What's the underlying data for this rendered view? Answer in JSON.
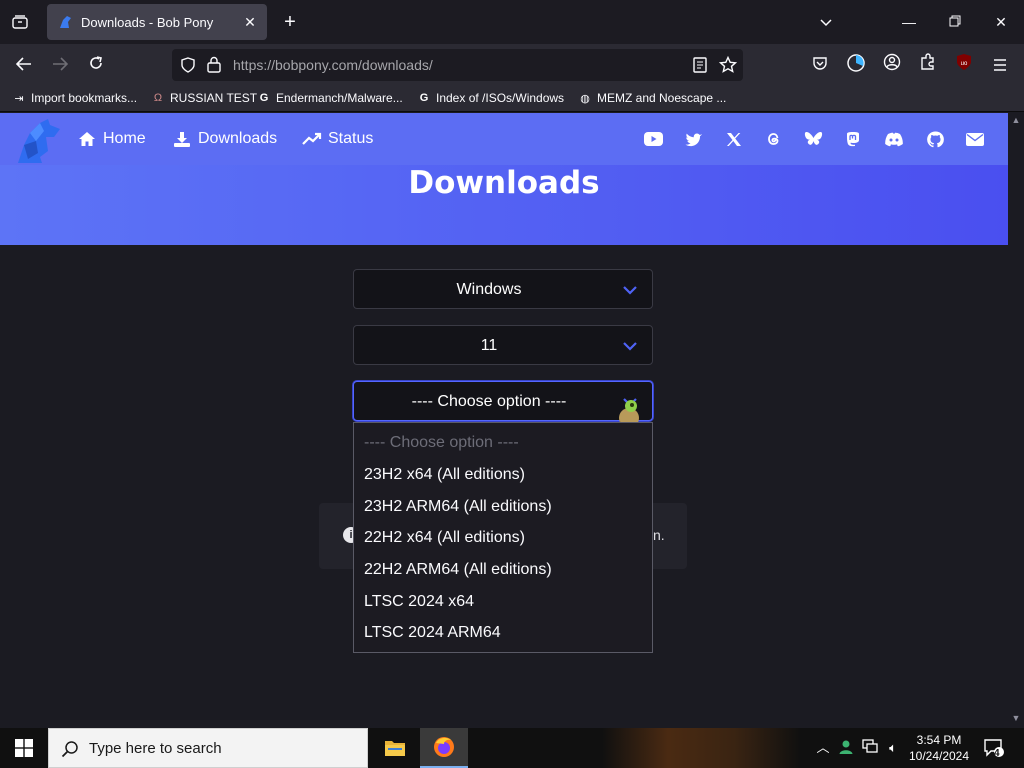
{
  "browser": {
    "tab_title": "Downloads - Bob Pony",
    "url_domain": "https://bobpony.com",
    "url_path": "/downloads/",
    "bookmarks": [
      {
        "label": "Import bookmarks..."
      },
      {
        "label": "RUSSIAN TEST"
      },
      {
        "label": "Endermanch/Malware..."
      },
      {
        "label": "Index of /ISOs/Windows"
      },
      {
        "label": "MEMZ and Noescape ..."
      }
    ]
  },
  "site": {
    "nav": [
      {
        "label": "Home",
        "icon": "home-icon"
      },
      {
        "label": "Downloads",
        "icon": "download-icon"
      },
      {
        "label": "Status",
        "icon": "trending-up-icon"
      }
    ],
    "social_icons": [
      "youtube-icon",
      "twitter-icon",
      "x-icon",
      "threads-icon",
      "bluesky-icon",
      "mastodon-icon",
      "discord-icon",
      "github-icon",
      "mail-icon"
    ],
    "hero_title": "Downloads",
    "selects": {
      "os": "Windows",
      "version": "11",
      "build": "---- Choose option ----"
    },
    "dropdown_options": [
      "---- Choose option ----",
      "23H2 x64 (All editions)",
      "23H2 ARM64 (All editions)",
      "22H2 x64 (All editions)",
      "22H2 ARM64 (All editions)",
      "LTSC 2024 x64",
      "LTSC 2024 ARM64"
    ],
    "info_tail": "n."
  },
  "taskbar": {
    "search_placeholder": "Type here to search",
    "time": "3:54 PM",
    "date": "10/24/2024",
    "notification_count": "4"
  },
  "colors": {
    "accent": "#5466ff",
    "header_blue": "#5c6df3"
  }
}
